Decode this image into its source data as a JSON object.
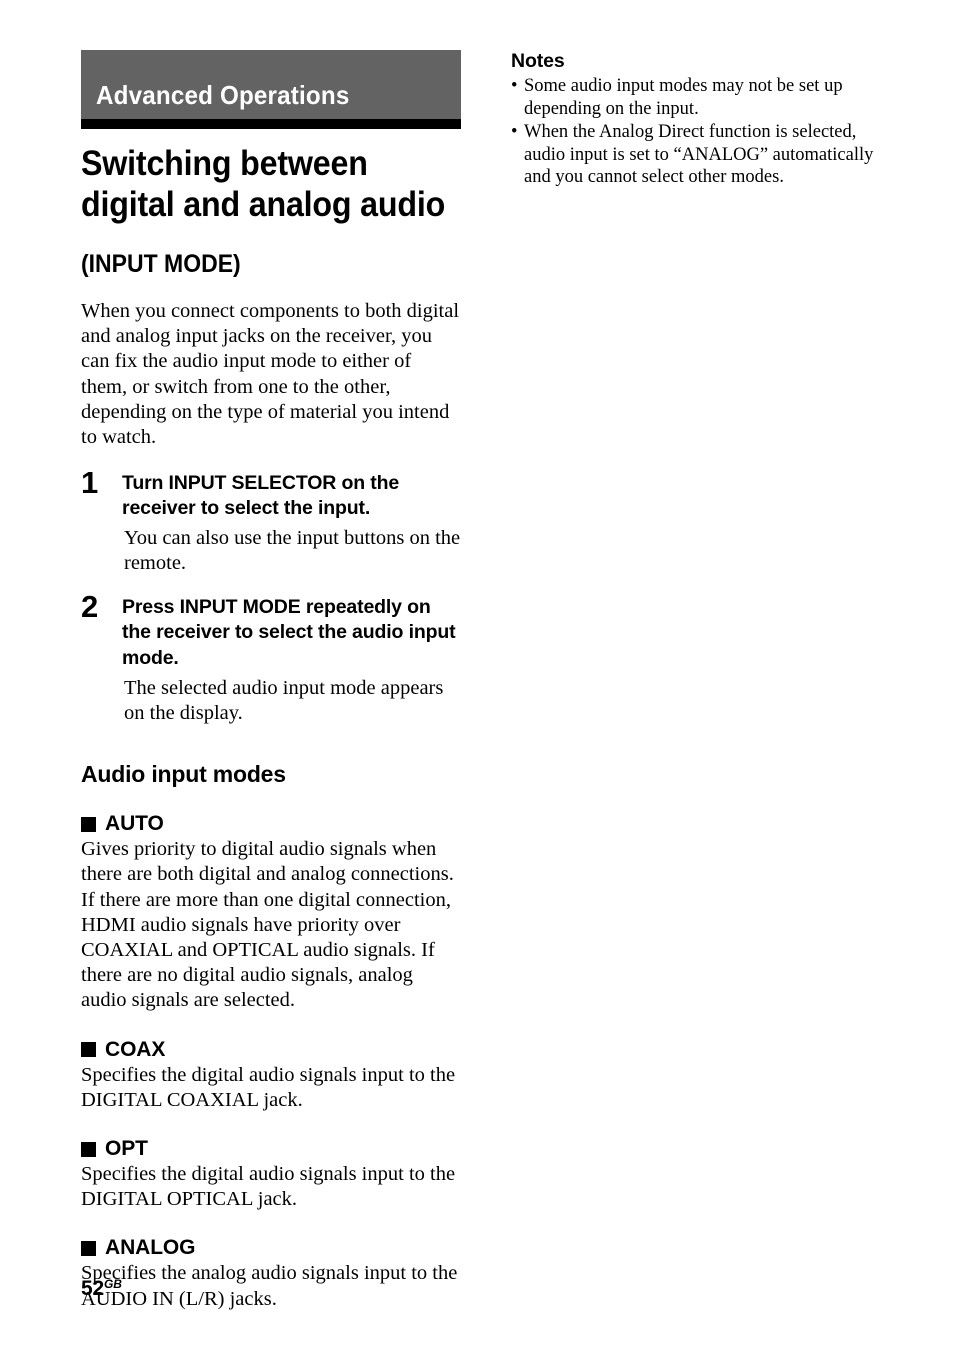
{
  "chapter": {
    "banner_label": "Advanced Operations",
    "banner_color": "#636363",
    "rule_color": "#000000"
  },
  "article": {
    "title_line1": "Switching between",
    "title_line2": "digital and analog audio",
    "subtitle": "(INPUT MODE)",
    "intro": "When you connect components to both digital and analog input jacks on the receiver, you can fix the audio input mode to either of them, or switch from one to the other, depending on the type of material you intend to watch."
  },
  "steps": [
    {
      "number": "1",
      "heading": "Turn INPUT SELECTOR on the receiver to select the input.",
      "body": "You can also use the input buttons on the remote."
    },
    {
      "number": "2",
      "heading": "Press INPUT MODE repeatedly on the receiver to select the audio input mode.",
      "body": "The selected audio input mode appears on the display."
    }
  ],
  "modes_section": {
    "heading": "Audio input modes",
    "items": [
      {
        "name": "AUTO",
        "description": "Gives priority to digital audio signals when there are both digital and analog connections. If there are more than one digital connection, HDMI audio signals have priority over COAXIAL and OPTICAL audio signals. If there are no digital audio signals, analog audio signals are selected."
      },
      {
        "name": "COAX",
        "description": "Specifies the digital audio signals input to the DIGITAL COAXIAL jack."
      },
      {
        "name": "OPT",
        "description": "Specifies the digital audio signals input to the DIGITAL OPTICAL jack."
      },
      {
        "name": "ANALOG",
        "description": "Specifies the analog audio signals input to the AUDIO IN (L/R) jacks."
      }
    ]
  },
  "notes": {
    "title": "Notes",
    "bullet_glyph": "•",
    "items": [
      "Some audio input modes may not be set up depending on the input.",
      "When the Analog Direct function is selected, audio input is set to “ANALOG” automatically and you cannot select other modes."
    ]
  },
  "folio": {
    "page_number": "52",
    "region_code": "GB"
  }
}
